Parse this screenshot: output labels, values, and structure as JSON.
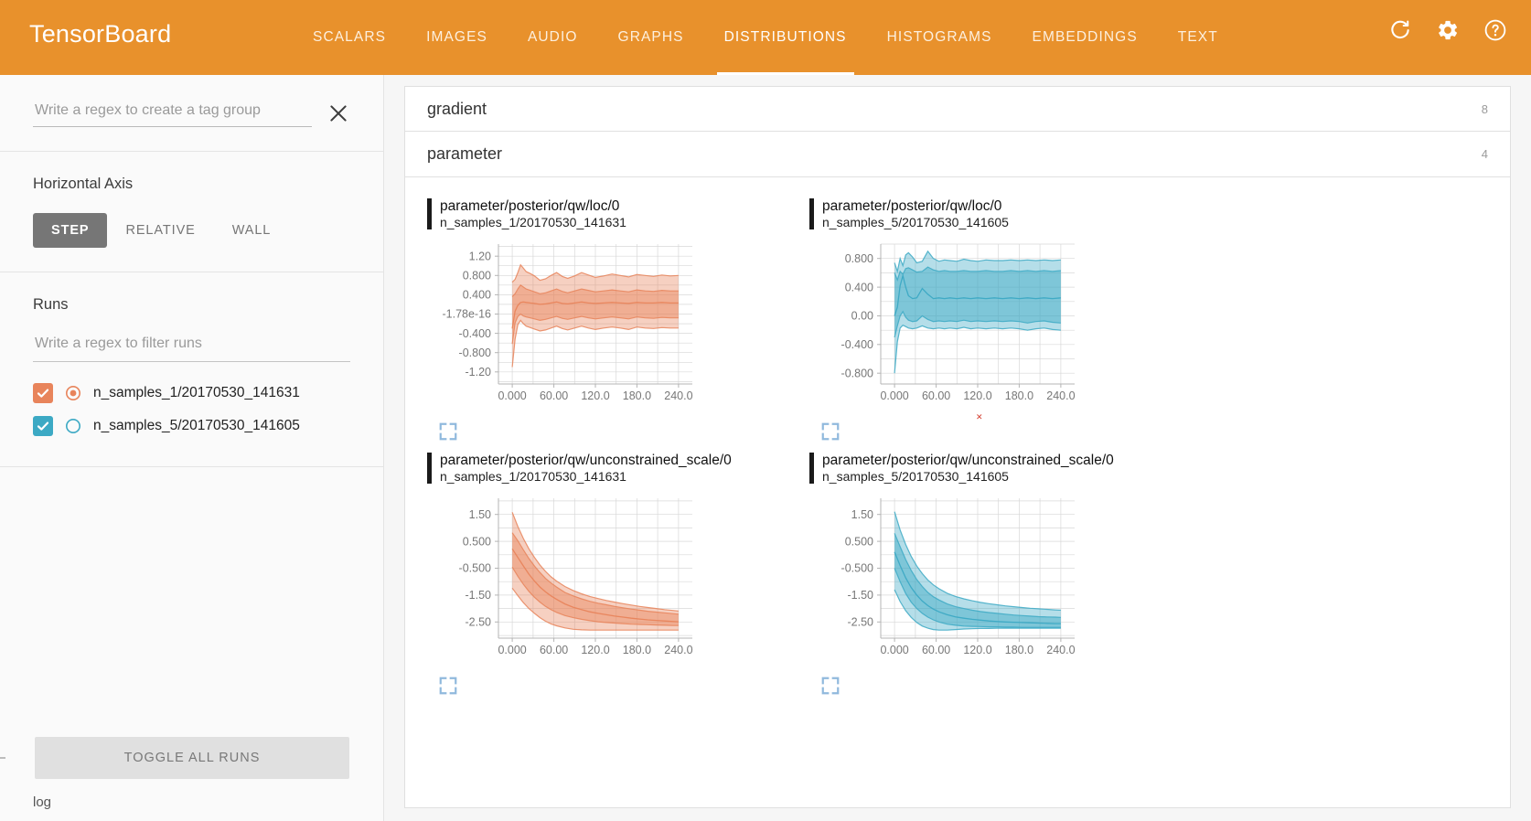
{
  "header": {
    "brand": "TensorBoard",
    "tabs": [
      {
        "label": "SCALARS",
        "active": false
      },
      {
        "label": "IMAGES",
        "active": false
      },
      {
        "label": "AUDIO",
        "active": false
      },
      {
        "label": "GRAPHS",
        "active": false
      },
      {
        "label": "DISTRIBUTIONS",
        "active": true
      },
      {
        "label": "HISTOGRAMS",
        "active": false
      },
      {
        "label": "EMBEDDINGS",
        "active": false
      },
      {
        "label": "TEXT",
        "active": false
      }
    ],
    "actions": [
      {
        "name": "refresh-icon"
      },
      {
        "name": "settings-gear-icon"
      },
      {
        "name": "help-icon"
      }
    ],
    "background_color": "#e8912c"
  },
  "sidebar": {
    "tag_filter": {
      "value": "",
      "placeholder": "Write a regex to create a tag group"
    },
    "clear_label": "×",
    "horizontal_axis": {
      "title": "Horizontal Axis",
      "options": [
        {
          "label": "STEP",
          "active": true
        },
        {
          "label": "RELATIVE",
          "active": false
        },
        {
          "label": "WALL",
          "active": false
        }
      ]
    },
    "runs": {
      "title": "Runs",
      "filter": {
        "value": "",
        "placeholder": "Write a regex to filter runs"
      },
      "items": [
        {
          "label": "n_samples_1/20170530_141631",
          "color": "#e8845b",
          "checked": true,
          "dot_filled": true
        },
        {
          "label": "n_samples_5/20170530_141605",
          "color": "#3ca9c4",
          "checked": true,
          "dot_filled": false
        }
      ]
    },
    "toggle_all_label": "TOGGLE ALL RUNS",
    "log_label": "log"
  },
  "main": {
    "accordions": [
      {
        "title": "gradient",
        "count": "8",
        "expanded": false
      },
      {
        "title": "parameter",
        "count": "4",
        "expanded": true
      }
    ],
    "x_ticks": [
      "0.000",
      "60.00",
      "120.0",
      "180.0",
      "240.0"
    ],
    "expand_icon_name": "expand-chart-icon"
  },
  "chart_data": [
    {
      "type": "area",
      "title": "parameter/posterior/qw/loc/0",
      "run": "n_samples_1/20170530_141631",
      "color": "#e8845b",
      "xlabel": "",
      "ylabel": "",
      "xlim": [
        -20,
        260
      ],
      "ylim": [
        -1.45,
        1.45
      ],
      "x_ticks": [
        "0.000",
        "60.00",
        "120.0",
        "180.0",
        "240.0"
      ],
      "x_tick_values": [
        0,
        60,
        120,
        180,
        240
      ],
      "y_ticks": [
        "1.20",
        "0.800",
        "0.400",
        "-1.78e-16",
        "-0.400",
        "-0.800",
        "-1.20"
      ],
      "y_tick_values": [
        1.2,
        0.8,
        0.4,
        0.0,
        -0.4,
        -0.8,
        -1.2
      ],
      "x": [
        0,
        4,
        8,
        12,
        16,
        20,
        26,
        32,
        40,
        48,
        56,
        64,
        72,
        80,
        90,
        100,
        110,
        120,
        132,
        144,
        156,
        168,
        180,
        192,
        204,
        216,
        228,
        240
      ],
      "series": [
        {
          "name": "max",
          "values": [
            0.66,
            0.72,
            0.86,
            1.02,
            0.95,
            0.88,
            0.84,
            0.79,
            0.7,
            0.73,
            0.8,
            0.86,
            0.78,
            0.74,
            0.79,
            0.86,
            0.81,
            0.76,
            0.79,
            0.83,
            0.8,
            0.77,
            0.82,
            0.8,
            0.78,
            0.81,
            0.79,
            0.8
          ]
        },
        {
          "name": "upper",
          "values": [
            0.36,
            0.42,
            0.52,
            0.6,
            0.56,
            0.52,
            0.49,
            0.46,
            0.42,
            0.44,
            0.48,
            0.52,
            0.47,
            0.44,
            0.48,
            0.52,
            0.49,
            0.46,
            0.48,
            0.5,
            0.48,
            0.46,
            0.5,
            0.48,
            0.47,
            0.49,
            0.48,
            0.48
          ]
        },
        {
          "name": "median",
          "values": [
            -0.3,
            0.06,
            0.18,
            0.24,
            0.25,
            0.24,
            0.23,
            0.22,
            0.2,
            0.21,
            0.23,
            0.25,
            0.22,
            0.21,
            0.23,
            0.25,
            0.23,
            0.22,
            0.23,
            0.24,
            0.23,
            0.22,
            0.24,
            0.23,
            0.23,
            0.24,
            0.23,
            0.23
          ]
        },
        {
          "name": "lower",
          "values": [
            -0.62,
            -0.18,
            -0.05,
            0.0,
            -0.04,
            -0.06,
            -0.08,
            -0.1,
            -0.13,
            -0.11,
            -0.08,
            -0.05,
            -0.09,
            -0.11,
            -0.08,
            -0.05,
            -0.08,
            -0.1,
            -0.08,
            -0.06,
            -0.08,
            -0.1,
            -0.06,
            -0.08,
            -0.09,
            -0.07,
            -0.08,
            -0.08
          ]
        },
        {
          "name": "min",
          "values": [
            -1.1,
            -0.52,
            -0.22,
            -0.13,
            -0.2,
            -0.25,
            -0.28,
            -0.31,
            -0.35,
            -0.33,
            -0.29,
            -0.25,
            -0.3,
            -0.33,
            -0.29,
            -0.25,
            -0.29,
            -0.32,
            -0.29,
            -0.27,
            -0.29,
            -0.32,
            -0.27,
            -0.29,
            -0.3,
            -0.28,
            -0.29,
            -0.29
          ]
        }
      ]
    },
    {
      "type": "area",
      "title": "parameter/posterior/qw/loc/0",
      "run": "n_samples_5/20170530_141605",
      "color": "#3ca9c4",
      "xlabel": "",
      "ylabel": "",
      "xlim": [
        -20,
        260
      ],
      "ylim": [
        -0.95,
        1.0
      ],
      "x_ticks": [
        "0.000",
        "60.00",
        "120.0",
        "180.0",
        "240.0"
      ],
      "x_tick_values": [
        0,
        60,
        120,
        180,
        240
      ],
      "y_ticks": [
        "0.800",
        "0.400",
        "0.00",
        "-0.400",
        "-0.800"
      ],
      "y_tick_values": [
        0.8,
        0.4,
        0.0,
        -0.4,
        -0.8
      ],
      "x": [
        0,
        4,
        8,
        12,
        16,
        20,
        26,
        32,
        40,
        48,
        56,
        64,
        72,
        80,
        90,
        100,
        110,
        120,
        132,
        144,
        156,
        168,
        180,
        192,
        204,
        216,
        228,
        240
      ],
      "series": [
        {
          "name": "max",
          "values": [
            0.74,
            0.62,
            0.8,
            0.7,
            0.85,
            0.88,
            0.82,
            0.74,
            0.76,
            0.9,
            0.8,
            0.76,
            0.78,
            0.77,
            0.76,
            0.79,
            0.77,
            0.76,
            0.78,
            0.77,
            0.77,
            0.78,
            0.77,
            0.78,
            0.77,
            0.78,
            0.77,
            0.78
          ]
        },
        {
          "name": "upper",
          "values": [
            0.6,
            0.5,
            0.62,
            0.58,
            0.66,
            0.67,
            0.64,
            0.61,
            0.62,
            0.68,
            0.64,
            0.62,
            0.63,
            0.62,
            0.62,
            0.63,
            0.62,
            0.62,
            0.63,
            0.62,
            0.62,
            0.63,
            0.62,
            0.63,
            0.62,
            0.63,
            0.62,
            0.63
          ]
        },
        {
          "name": "median",
          "values": [
            0.0,
            0.12,
            0.42,
            0.56,
            0.4,
            0.28,
            0.24,
            0.25,
            0.38,
            0.3,
            0.24,
            0.25,
            0.24,
            0.25,
            0.24,
            0.25,
            0.24,
            0.25,
            0.24,
            0.25,
            0.24,
            0.25,
            0.24,
            0.25,
            0.24,
            0.25,
            0.24,
            0.25
          ]
        },
        {
          "name": "lower",
          "values": [
            -0.3,
            -0.14,
            0.0,
            0.06,
            -0.02,
            -0.06,
            -0.08,
            -0.07,
            0.0,
            -0.05,
            -0.08,
            -0.07,
            -0.08,
            -0.07,
            -0.08,
            -0.06,
            -0.08,
            -0.07,
            -0.08,
            -0.07,
            -0.08,
            -0.07,
            -0.08,
            -0.1,
            -0.08,
            -0.07,
            -0.09,
            -0.1
          ]
        },
        {
          "name": "min",
          "values": [
            -0.8,
            -0.36,
            -0.17,
            -0.13,
            -0.15,
            -0.17,
            -0.18,
            -0.17,
            -0.14,
            -0.17,
            -0.18,
            -0.17,
            -0.18,
            -0.17,
            -0.18,
            -0.16,
            -0.18,
            -0.17,
            -0.18,
            -0.17,
            -0.18,
            -0.17,
            -0.18,
            -0.2,
            -0.18,
            -0.17,
            -0.19,
            -0.2
          ]
        }
      ]
    },
    {
      "type": "area",
      "title": "parameter/posterior/qw/unconstrained_scale/0",
      "run": "n_samples_1/20170530_141631",
      "color": "#e8845b",
      "xlabel": "",
      "ylabel": "",
      "xlim": [
        -20,
        260
      ],
      "ylim": [
        -3.1,
        2.1
      ],
      "x_ticks": [
        "0.000",
        "60.00",
        "120.0",
        "180.0",
        "240.0"
      ],
      "x_tick_values": [
        0,
        60,
        120,
        180,
        240
      ],
      "y_ticks": [
        "1.50",
        "0.500",
        "-0.500",
        "-1.50",
        "-2.50"
      ],
      "y_tick_values": [
        1.5,
        0.5,
        -0.5,
        -1.5,
        -2.5
      ],
      "x": [
        0,
        8,
        16,
        24,
        32,
        40,
        48,
        56,
        64,
        76,
        88,
        100,
        112,
        124,
        136,
        148,
        160,
        172,
        184,
        196,
        208,
        220,
        232,
        240
      ],
      "series": [
        {
          "name": "max",
          "values": [
            1.58,
            1.05,
            0.6,
            0.22,
            -0.1,
            -0.38,
            -0.62,
            -0.82,
            -0.98,
            -1.18,
            -1.33,
            -1.45,
            -1.55,
            -1.63,
            -1.7,
            -1.76,
            -1.82,
            -1.87,
            -1.92,
            -1.96,
            -2.0,
            -2.04,
            -2.07,
            -2.09
          ]
        },
        {
          "name": "upper",
          "values": [
            0.82,
            0.52,
            0.18,
            -0.14,
            -0.42,
            -0.66,
            -0.88,
            -1.05,
            -1.2,
            -1.4,
            -1.53,
            -1.64,
            -1.73,
            -1.8,
            -1.86,
            -1.92,
            -1.97,
            -2.02,
            -2.06,
            -2.1,
            -2.13,
            -2.16,
            -2.19,
            -2.21
          ]
        },
        {
          "name": "median",
          "values": [
            0.22,
            -0.1,
            -0.42,
            -0.72,
            -0.98,
            -1.2,
            -1.38,
            -1.53,
            -1.66,
            -1.83,
            -1.95,
            -2.04,
            -2.12,
            -2.18,
            -2.23,
            -2.28,
            -2.32,
            -2.36,
            -2.39,
            -2.42,
            -2.44,
            -2.46,
            -2.48,
            -2.49
          ]
        },
        {
          "name": "lower",
          "values": [
            -0.46,
            -0.8,
            -1.1,
            -1.36,
            -1.58,
            -1.76,
            -1.92,
            -2.04,
            -2.14,
            -2.26,
            -2.34,
            -2.4,
            -2.45,
            -2.49,
            -2.52,
            -2.54,
            -2.56,
            -2.58,
            -2.59,
            -2.6,
            -2.61,
            -2.62,
            -2.63,
            -2.63
          ]
        },
        {
          "name": "min",
          "values": [
            -1.24,
            -1.52,
            -1.78,
            -2.0,
            -2.18,
            -2.34,
            -2.47,
            -2.57,
            -2.64,
            -2.72,
            -2.77,
            -2.79,
            -2.8,
            -2.8,
            -2.8,
            -2.8,
            -2.8,
            -2.8,
            -2.8,
            -2.8,
            -2.8,
            -2.8,
            -2.8,
            -2.8
          ]
        }
      ]
    },
    {
      "type": "area",
      "title": "parameter/posterior/qw/unconstrained_scale/0",
      "run": "n_samples_5/20170530_141605",
      "color": "#3ca9c4",
      "xlabel": "",
      "ylabel": "",
      "xlim": [
        -20,
        260
      ],
      "ylim": [
        -3.1,
        2.1
      ],
      "x_ticks": [
        "0.000",
        "60.00",
        "120.0",
        "180.0",
        "240.0"
      ],
      "x_tick_values": [
        0,
        60,
        120,
        180,
        240
      ],
      "y_ticks": [
        "1.50",
        "0.500",
        "-0.500",
        "-1.50",
        "-2.50"
      ],
      "y_tick_values": [
        1.5,
        0.5,
        -0.5,
        -1.5,
        -2.5
      ],
      "x": [
        0,
        8,
        16,
        24,
        32,
        40,
        48,
        56,
        64,
        76,
        88,
        100,
        112,
        124,
        136,
        148,
        160,
        172,
        184,
        196,
        208,
        220,
        232,
        240
      ],
      "series": [
        {
          "name": "max",
          "values": [
            1.6,
            0.92,
            0.38,
            -0.06,
            -0.42,
            -0.7,
            -0.94,
            -1.12,
            -1.26,
            -1.43,
            -1.55,
            -1.64,
            -1.71,
            -1.77,
            -1.82,
            -1.86,
            -1.9,
            -1.93,
            -1.96,
            -1.99,
            -2.01,
            -2.03,
            -2.05,
            -2.06
          ]
        },
        {
          "name": "upper",
          "values": [
            0.8,
            0.3,
            -0.18,
            -0.58,
            -0.92,
            -1.18,
            -1.4,
            -1.56,
            -1.68,
            -1.83,
            -1.93,
            -2.0,
            -2.06,
            -2.11,
            -2.15,
            -2.18,
            -2.21,
            -2.24,
            -2.26,
            -2.28,
            -2.3,
            -2.31,
            -2.32,
            -2.33
          ]
        },
        {
          "name": "median",
          "values": [
            0.1,
            -0.4,
            -0.86,
            -1.22,
            -1.5,
            -1.72,
            -1.89,
            -2.02,
            -2.12,
            -2.23,
            -2.31,
            -2.36,
            -2.4,
            -2.43,
            -2.46,
            -2.48,
            -2.5,
            -2.51,
            -2.52,
            -2.53,
            -2.54,
            -2.55,
            -2.56,
            -2.56
          ]
        },
        {
          "name": "lower",
          "values": [
            -0.5,
            -1.0,
            -1.44,
            -1.76,
            -2.0,
            -2.18,
            -2.32,
            -2.42,
            -2.5,
            -2.58,
            -2.62,
            -2.65,
            -2.66,
            -2.67,
            -2.68,
            -2.68,
            -2.69,
            -2.69,
            -2.7,
            -2.7,
            -2.7,
            -2.7,
            -2.7,
            -2.7
          ]
        },
        {
          "name": "min",
          "values": [
            -1.3,
            -1.74,
            -2.08,
            -2.33,
            -2.52,
            -2.65,
            -2.73,
            -2.78,
            -2.8,
            -2.8,
            -2.78,
            -2.76,
            -2.75,
            -2.74,
            -2.74,
            -2.73,
            -2.73,
            -2.73,
            -2.73,
            -2.73,
            -2.73,
            -2.73,
            -2.73,
            -2.73
          ]
        }
      ]
    }
  ]
}
